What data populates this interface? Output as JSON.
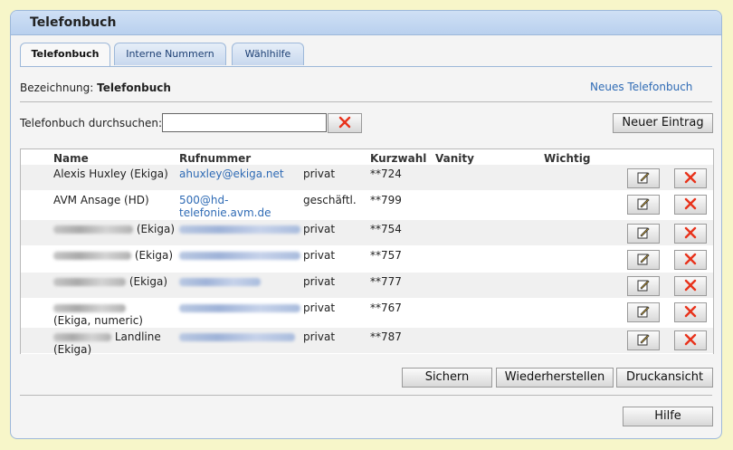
{
  "panel": {
    "title": "Telefonbuch"
  },
  "tabs": [
    {
      "label": "Telefonbuch",
      "active": true
    },
    {
      "label": "Interne Nummern",
      "active": false
    },
    {
      "label": "Wählhilfe",
      "active": false
    }
  ],
  "info": {
    "bezeichnung_label": "Bezeichnung:",
    "bezeichnung_value": "Telefonbuch",
    "new_phonebook_link": "Neues Telefonbuch"
  },
  "search": {
    "label": "Telefonbuch durchsuchen:",
    "value": "",
    "placeholder": ""
  },
  "toolbar": {
    "new_entry": "Neuer Eintrag"
  },
  "table": {
    "headers": {
      "name": "Name",
      "number": "Rufnummer",
      "speed": "Kurzwahl",
      "vanity": "Vanity",
      "important": "Wichtig"
    },
    "rows": [
      {
        "name": "Alexis Huxley (Ekiga)",
        "number": "ahuxley@ekiga.net",
        "type": "privat",
        "speed": "**724"
      },
      {
        "name": "AVM Ansage (HD)",
        "number": "500@hd-telefonie.avm.de",
        "type": "geschäftl.",
        "speed": "**799"
      },
      {
        "name": " (Ekiga)",
        "number": "",
        "type": "privat",
        "speed": "**754"
      },
      {
        "name": " (Ekiga)",
        "number": "",
        "type": "privat",
        "speed": "**757"
      },
      {
        "name": " (Ekiga)",
        "number": "",
        "type": "privat",
        "speed": "**777"
      },
      {
        "name": " (Ekiga, numeric)",
        "number": "",
        "type": "privat",
        "speed": "**767"
      },
      {
        "name": " Landline (Ekiga)",
        "number": "",
        "type": "privat",
        "speed": "**787"
      }
    ]
  },
  "footer_buttons": {
    "save": "Sichern",
    "restore": "Wiederherstellen",
    "print": "Druckansicht",
    "help": "Hilfe"
  },
  "icons": {
    "edit": "edit-icon",
    "delete": "delete-icon",
    "delete_color": "#e8331c"
  }
}
